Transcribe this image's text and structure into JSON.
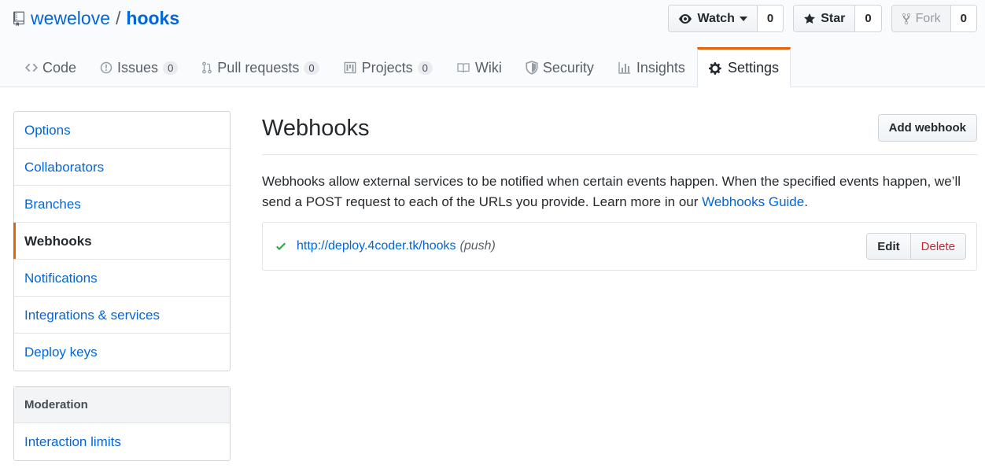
{
  "repo": {
    "owner": "wewelove",
    "separator": "/",
    "name": "hooks"
  },
  "actions": {
    "watch": {
      "label": "Watch",
      "count": "0"
    },
    "star": {
      "label": "Star",
      "count": "0"
    },
    "fork": {
      "label": "Fork",
      "count": "0"
    }
  },
  "tabs": [
    {
      "label": "Code",
      "icon": "code-icon"
    },
    {
      "label": "Issues",
      "count": "0",
      "icon": "issue-icon"
    },
    {
      "label": "Pull requests",
      "count": "0",
      "icon": "pull-request-icon"
    },
    {
      "label": "Projects",
      "count": "0",
      "icon": "project-icon"
    },
    {
      "label": "Wiki",
      "icon": "book-icon"
    },
    {
      "label": "Security",
      "icon": "shield-icon"
    },
    {
      "label": "Insights",
      "icon": "graph-icon"
    },
    {
      "label": "Settings",
      "icon": "gear-icon",
      "selected": true
    }
  ],
  "sidebar": {
    "items": [
      "Options",
      "Collaborators",
      "Branches",
      "Webhooks",
      "Notifications",
      "Integrations & services",
      "Deploy keys"
    ],
    "moderation_heading": "Moderation",
    "moderation_items": [
      "Interaction limits"
    ]
  },
  "main": {
    "title": "Webhooks",
    "add_button": "Add webhook",
    "description_line1": "Webhooks allow external services to be notified when certain events happen. When the specified events happen, we’ll",
    "description_line2": "send a POST request to each of the URLs you provide. Learn more in our ",
    "guide_link": "Webhooks Guide",
    "description_end": ".",
    "hook": {
      "url": "http://deploy.4coder.tk/hooks",
      "events": "(push)",
      "edit": "Edit",
      "delete": "Delete"
    }
  },
  "colors": {
    "accent": "#e36209",
    "link": "#0366d6",
    "success": "#28a745",
    "danger": "#cb2431"
  }
}
